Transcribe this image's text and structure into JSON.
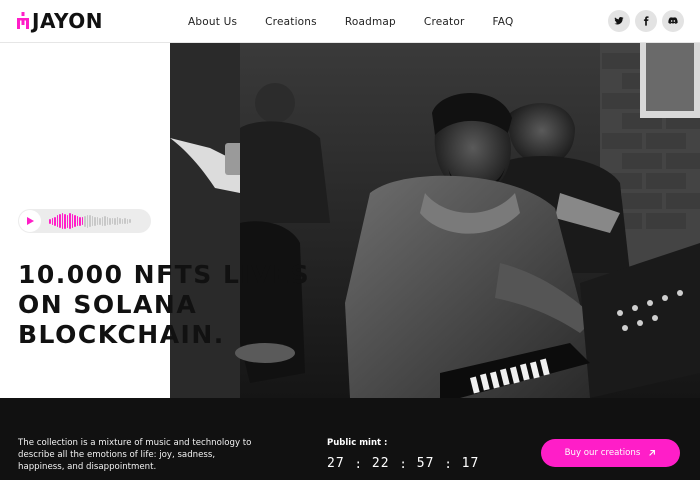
{
  "brand": {
    "logo_text": "JAYON",
    "accent_color": "#ff1ec8"
  },
  "nav": {
    "links": [
      "About Us",
      "Creations",
      "Roadmap",
      "Creator",
      "FAQ"
    ]
  },
  "socials": [
    {
      "name": "twitter-icon"
    },
    {
      "name": "facebook-icon"
    },
    {
      "name": "discord-icon"
    }
  ],
  "hero": {
    "headline_lines": [
      "10.000 NFTS LIVES",
      "ON SOLANA",
      "BLOCKCHAIN."
    ],
    "audio_player": {
      "play_icon": "play-icon",
      "waveform_icon": "waveform-icon"
    },
    "photo": {
      "subject": "black-and-white photo of musicians at a keyboard in a studio"
    }
  },
  "footer": {
    "description": "The collection is a mixture of music and technology to describe all the emotions of life: joy, sadness, happiness, and disappointment.",
    "mint_label": "Public mint :",
    "countdown": [
      "27",
      "22",
      "57",
      "17"
    ],
    "buy_button_label": "Buy our creations",
    "buy_button_icon": "arrow-up-right-icon"
  }
}
